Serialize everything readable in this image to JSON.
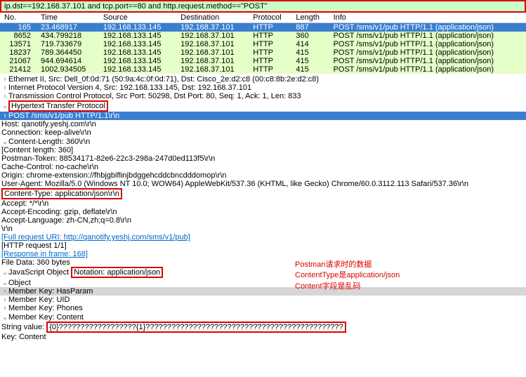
{
  "filter": "ip.dst==192.168.37.101 and tcp.port==80 and http.request.method==\"POST\"",
  "columns": {
    "no": "No.",
    "time": "Time",
    "source": "Source",
    "destination": "Destination",
    "protocol": "Protocol",
    "length": "Length",
    "info": "Info"
  },
  "packets": [
    {
      "no": "165",
      "time": "23.468917",
      "src": "192.168.133.145",
      "dst": "192.168.37.101",
      "proto": "HTTP",
      "len": "887",
      "info": "POST /sms/v1/pub HTTP/1.1  (application/json)"
    },
    {
      "no": "8652",
      "time": "434.799218",
      "src": "192.168.133.145",
      "dst": "192.168.37.101",
      "proto": "HTTP",
      "len": "360",
      "info": "POST /sms/v1/pub HTTP/1.1  (application/json)"
    },
    {
      "no": "13571",
      "time": "719.733679",
      "src": "192.168.133.145",
      "dst": "192.168.37.101",
      "proto": "HTTP",
      "len": "414",
      "info": "POST /sms/v1/pub HTTP/1.1  (application/json)"
    },
    {
      "no": "18237",
      "time": "789.364450",
      "src": "192.168.133.145",
      "dst": "192.168.37.101",
      "proto": "HTTP",
      "len": "415",
      "info": "POST /sms/v1/pub HTTP/1.1  (application/json)"
    },
    {
      "no": "21067",
      "time": "944.694614",
      "src": "192.168.133.145",
      "dst": "192.168.37.101",
      "proto": "HTTP",
      "len": "415",
      "info": "POST /sms/v1/pub HTTP/1.1  (application/json)"
    },
    {
      "no": "21412",
      "time": "1002.934505",
      "src": "192.168.133.145",
      "dst": "192.168.37.101",
      "proto": "HTTP",
      "len": "415",
      "info": "POST /sms/v1/pub HTTP/1.1  (application/json)"
    }
  ],
  "tree": {
    "eth": "Ethernet II, Src: Dell_0f:0d:71 (50:9a:4c:0f:0d:71), Dst: Cisco_2e:d2:c8 (00:c8:8b:2e:d2:c8)",
    "ip": "Internet Protocol Version 4, Src: 192.168.133.145, Dst: 192.168.37.101",
    "tcp": "Transmission Control Protocol, Src Port: 50298, Dst Port: 80, Seq: 1, Ack: 1, Len: 833",
    "http": "Hypertext Transfer Protocol",
    "post": "POST /sms/v1/pub HTTP/1.1\\r\\n",
    "host": "Host: qanotify.yeshj.com\\r\\n",
    "conn": "Connection: keep-alive\\r\\n",
    "cl": "Content-Length: 360\\r\\n",
    "cl2": "[Content length: 360]",
    "pt": "Postman-Token: 88534171-82e6-22c3-298a-247d0ed113f5\\r\\n",
    "cc": "Cache-Control: no-cache\\r\\n",
    "org": "Origin: chrome-extension://fhbjgbiflinjbdggehcddcbncdddomop\\r\\n",
    "ua": "User-Agent: Mozilla/5.0 (Windows NT 10.0; WOW64) AppleWebKit/537.36 (KHTML, like Gecko) Chrome/60.0.3112.113 Safari/537.36\\r\\n",
    "ct": "Content-Type: application/json\\r\\n",
    "acc": "Accept: */*\\r\\n",
    "ae": "Accept-Encoding: gzip, deflate\\r\\n",
    "al": "Accept-Language: zh-CN,zh;q=0.8\\r\\n",
    "crlf": "\\r\\n",
    "full": "[Full request URI: http://qanotify.yeshj.com/sms/v1/pub]",
    "req": "[HTTP request 1/1]",
    "resp": "[Response in frame: 168]",
    "fd": "File Data: 360 bytes",
    "json": "JavaScript Object Notation: application/json",
    "jsonlabel": "Notation: application/json",
    "jsonpre": "JavaScript Object ",
    "obj": "Object",
    "mk1": "Member Key: HasParam",
    "mk2": "Member Key: UID",
    "mk3": "Member Key: Phones",
    "mk4": "Member Key: Content",
    "strlabel": "String value: ",
    "strval": "{0}??????????????????{1}??????????????????????????????????????????????",
    "key": "Key: Content"
  },
  "annot": {
    "l1": "Postman请求时的数据",
    "l2": "ContentType是application/json",
    "l3": "Content字段是乱码"
  },
  "carets": {
    "right": "›",
    "down": "⌄"
  }
}
